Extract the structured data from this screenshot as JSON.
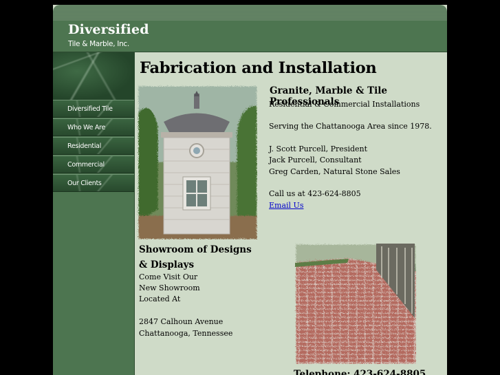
{
  "brand": {
    "name": "Diversified",
    "subtitle": "Tile & Marble, Inc."
  },
  "nav": {
    "items": [
      {
        "label": "Diversified Tile"
      },
      {
        "label": "Who We Are"
      },
      {
        "label": "Residential"
      },
      {
        "label": "Commercial"
      },
      {
        "label": "Our Clients"
      }
    ]
  },
  "main": {
    "title": "Fabrication and Installation",
    "pro_heading": "Granite, Marble & Tile Professionals",
    "lines": [
      "Residential & Commercial Installations",
      "Serving the Chattanooga Area since 1978.",
      "J. Scott Purcell, President",
      "Jack Purcell, Consultant",
      "Greg Carden, Natural Stone Sales",
      "Call us at 423-624-8805"
    ],
    "email_link": "Email Us"
  },
  "showroom": {
    "heading": "Showroom of Designs & Displays",
    "lines": [
      "Come Visit Our",
      "New Showroom",
      "Located At",
      "2847 Calhoun Avenue",
      "Chattanooga, Tennessee"
    ],
    "cutoff": "Telephone: 423-624-8805"
  },
  "colors": {
    "page_bg": "#000000",
    "content_bg": "#cfdbc8",
    "brand_green": "#4d7550",
    "link": "#0000cc"
  }
}
